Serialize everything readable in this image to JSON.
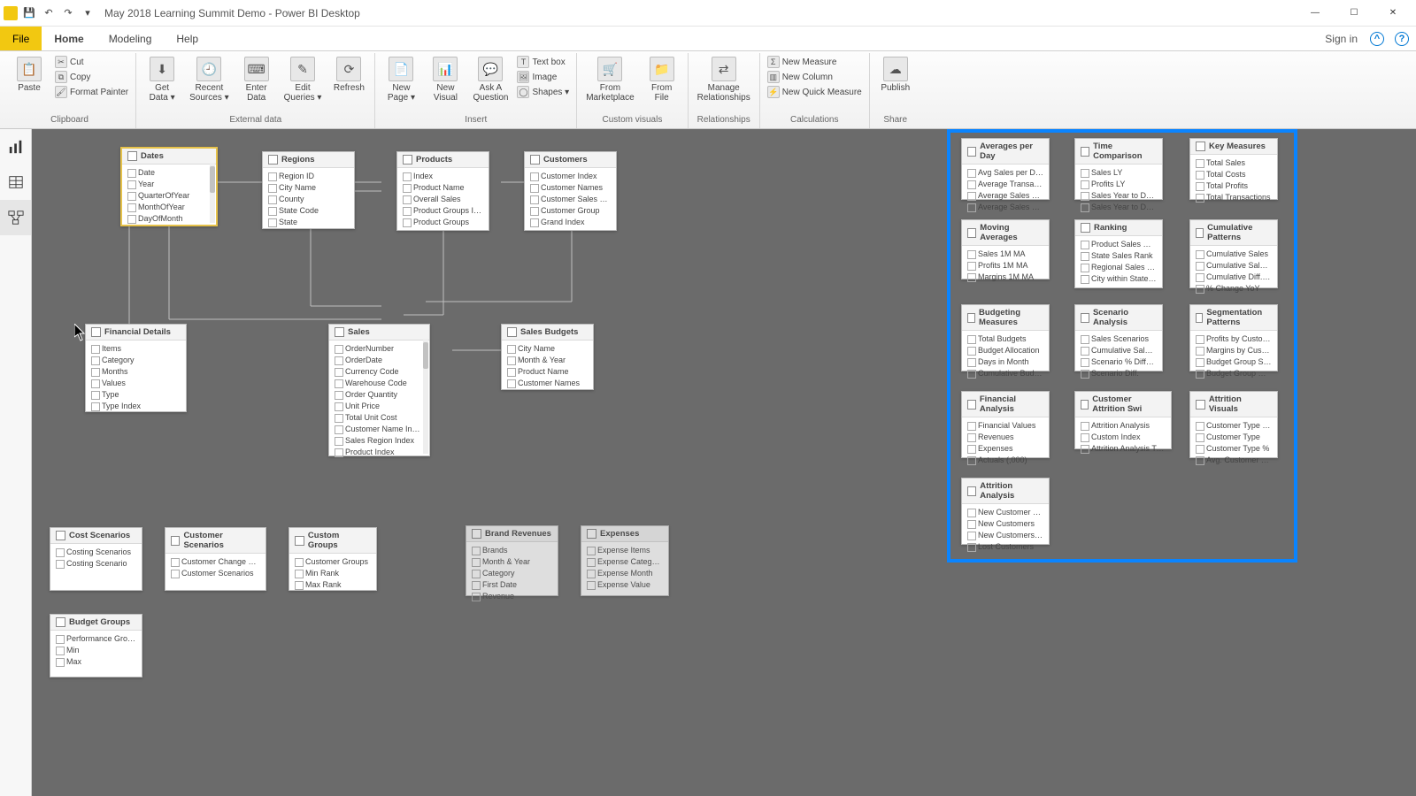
{
  "window": {
    "title": "May 2018 Learning Summit Demo - Power BI Desktop",
    "signin": "Sign in"
  },
  "tabs": {
    "file": "File",
    "home": "Home",
    "modeling": "Modeling",
    "help": "Help"
  },
  "ribbon": {
    "clipboard": {
      "paste": "Paste",
      "cut": "Cut",
      "copy": "Copy",
      "fmt": "Format Painter",
      "label": "Clipboard"
    },
    "external": {
      "getdata": "Get\nData ▾",
      "recent": "Recent\nSources ▾",
      "enter": "Enter\nData",
      "edit": "Edit\nQueries ▾",
      "refresh": "Refresh",
      "label": "External data"
    },
    "insert": {
      "newpage": "New\nPage ▾",
      "newvisual": "New\nVisual",
      "ask": "Ask A\nQuestion",
      "textbox": "Text box",
      "image": "Image",
      "shapes": "Shapes ▾",
      "label": "Insert"
    },
    "custom": {
      "market": "From\nMarketplace",
      "fromfile": "From\nFile",
      "label": "Custom visuals"
    },
    "rels": {
      "manage": "Manage\nRelationships",
      "label": "Relationships"
    },
    "calc": {
      "measure": "New Measure",
      "column": "New Column",
      "quick": "New Quick Measure",
      "label": "Calculations"
    },
    "share": {
      "publish": "Publish",
      "label": "Share"
    }
  },
  "tables": {
    "dates": {
      "title": "Dates",
      "fields": [
        "Date",
        "Year",
        "QuarterOfYear",
        "MonthOfYear",
        "DayOfMonth"
      ]
    },
    "regions": {
      "title": "Regions",
      "fields": [
        "Region ID",
        "City Name",
        "County",
        "State Code",
        "State"
      ]
    },
    "products": {
      "title": "Products",
      "fields": [
        "Index",
        "Product Name",
        "Overall Sales",
        "Product Groups Ind.",
        "Product Groups"
      ]
    },
    "customers": {
      "title": "Customers",
      "fields": [
        "Customer Index",
        "Customer Names",
        "Customer Sales Rank",
        "Customer Group",
        "Grand Index"
      ]
    },
    "findet": {
      "title": "Financial Details",
      "fields": [
        "Items",
        "Category",
        "Months",
        "Values",
        "Type",
        "Type Index"
      ]
    },
    "sales": {
      "title": "Sales",
      "fields": [
        "OrderNumber",
        "OrderDate",
        "Currency Code",
        "Warehouse Code",
        "Order Quantity",
        "Unit Price",
        "Total Unit Cost",
        "Customer Name Index",
        "Sales Region Index",
        "Product Index"
      ]
    },
    "salesb": {
      "title": "Sales Budgets",
      "fields": [
        "City Name",
        "Month & Year",
        "Product Name",
        "Customer Names"
      ]
    },
    "costsc": {
      "title": "Cost Scenarios",
      "fields": [
        "Costing Scenarios",
        "Costing Scenario"
      ]
    },
    "custsc": {
      "title": "Customer Scenarios",
      "fields": [
        "Customer Change Scen.",
        "Customer Scenarios"
      ]
    },
    "custgr": {
      "title": "Custom Groups",
      "fields": [
        "Customer Groups",
        "Min Rank",
        "Max Rank"
      ]
    },
    "brandrev": {
      "title": "Brand Revenues",
      "fields": [
        "Brands",
        "Month & Year",
        "Category",
        "First Date",
        "Revenue"
      ]
    },
    "expenses": {
      "title": "Expenses",
      "fields": [
        "Expense Items",
        "Expense Category",
        "Expense Month",
        "Expense Value"
      ]
    },
    "budgetg": {
      "title": "Budget Groups",
      "fields": [
        "Performance Groups",
        "Min",
        "Max"
      ]
    },
    "avgday": {
      "title": "Averages per Day",
      "fields": [
        "Avg Sales per Day",
        "Average Transactions",
        "Average Sales per M",
        "Average Sales per Cu"
      ]
    },
    "timecomp": {
      "title": "Time Comparison",
      "fields": [
        "Sales LY",
        "Profits LY",
        "Sales Year to Date",
        "Sales Year to Date LY"
      ]
    },
    "keymeas": {
      "title": "Key Measures",
      "fields": [
        "Total Sales",
        "Total Costs",
        "Total Profits",
        "Total Transactions"
      ]
    },
    "movavg": {
      "title": "Moving Averages",
      "fields": [
        "Sales 1M MA",
        "Profits 1M MA",
        "Margins 1M MA"
      ]
    },
    "ranking": {
      "title": "Ranking",
      "fields": [
        "Product Sales Rank",
        "State Sales Rank",
        "Regional Sales Rank",
        "City within State Sale"
      ]
    },
    "cumpat": {
      "title": "Cumulative Patterns",
      "fields": [
        "Cumulative Sales",
        "Cumulative Sales LY",
        "Cumulative Diff. vs C",
        "% Change YoY"
      ]
    },
    "budmeas": {
      "title": "Budgeting Measures",
      "fields": [
        "Total Budgets",
        "Budget Allocation",
        "Days in Month",
        "Cumulative Budgets"
      ]
    },
    "scenan": {
      "title": "Scenario Analysis",
      "fields": [
        "Sales Scenarios",
        "Cumulative Sales Sc",
        "Scenario % Differenc",
        "Scenario Diff."
      ]
    },
    "segpat": {
      "title": "Segmentation Patterns",
      "fields": [
        "Profits by Custom Gr",
        "Margins by Custom G",
        "Budget Group Sales",
        "Budget Group Count"
      ]
    },
    "finan": {
      "title": "Financial Analysis",
      "fields": [
        "Financial Values",
        "Revenues",
        "Expenses",
        "Actuals (,000)"
      ]
    },
    "custattr": {
      "title": "Customer Attrition Swi",
      "fields": [
        "Attrition Analysis",
        "Custom Index",
        "Attrition Analysis Type"
      ]
    },
    "attrvis": {
      "title": "Attrition Visuals",
      "fields": [
        "Customer Type Sales",
        "Customer Type",
        "Customer Type %",
        "Avg. Customer Type"
      ]
    },
    "attran": {
      "title": "Attrition Analysis",
      "fields": [
        "New Customer Sales",
        "New Customers",
        "New Customers %",
        "Lost Customers"
      ]
    }
  }
}
